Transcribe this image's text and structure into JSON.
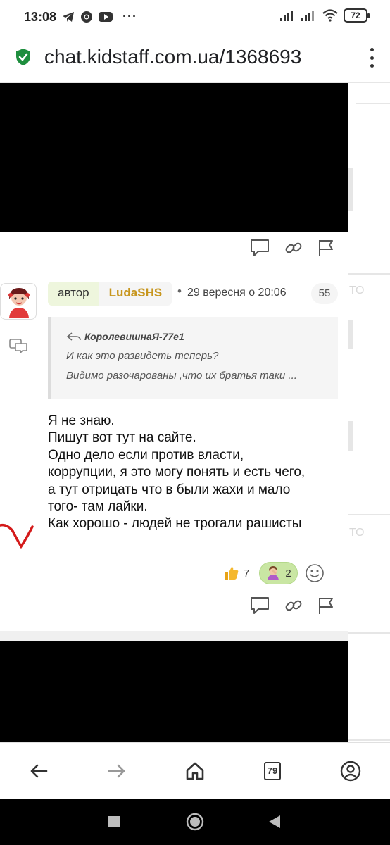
{
  "status_bar": {
    "time": "13:08",
    "left_icons": [
      "telegram-icon",
      "chrome-icon",
      "youtube-icon",
      "more-notifications-icon"
    ],
    "right_icons": [
      "signal-icon",
      "signal-icon",
      "wifi-icon"
    ],
    "battery": "72"
  },
  "address_bar": {
    "url": "chat.kidstaff.com.ua/1368693",
    "secure_icon": "shield-check-icon",
    "menu_icon": "more-vert-icon"
  },
  "post": {
    "role_label": "автор",
    "username": "LudaSHS",
    "separator": "•",
    "date": "29 вересня о 20:06",
    "number": "55",
    "quote": {
      "author": "КоролевишнаЯ-77е1",
      "lines": [
        "И как это развидеть теперь?",
        "Видимо разочарованы ,что их братья таки ..."
      ]
    },
    "message_lines": [
      "Я не знаю.",
      "Пишут вот тут на сайте.",
      "Одно дело если против власти,",
      "коррупции, я это могу понять и есть чего,",
      "а тут отрицать что в были жахи и мало",
      "того- там лайки.",
      "Как хорошо - людей не трогали рашисты"
    ],
    "reactions": [
      {
        "icon": "thumbs-up-icon",
        "count": "7"
      },
      {
        "icon": "facepalm-icon",
        "count": "2"
      }
    ],
    "add_reaction_icon": "smile-add-icon",
    "actions": [
      "reply-icon",
      "link-icon",
      "flag-icon"
    ]
  },
  "ghost_sidebar": {
    "text_1": "ТО",
    "text_2": "ТО"
  },
  "bottom_nav": {
    "tab_count": "79",
    "items": [
      "back-arrow-icon",
      "forward-arrow-icon",
      "home-icon",
      "tabs-icon",
      "account-icon"
    ]
  },
  "colors": {
    "accent_green": "#c9e6a3",
    "role_chip": "#eef6dd",
    "username": "#c7961e",
    "secure_green": "#1e8e3e"
  }
}
